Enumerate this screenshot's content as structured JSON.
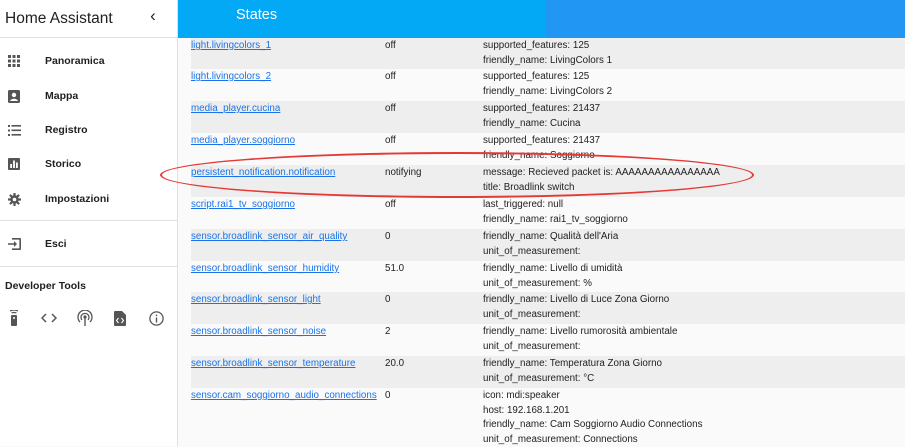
{
  "sidebar": {
    "title": "Home Assistant",
    "items": [
      {
        "label": "Panoramica",
        "icon": "apps-grid-icon"
      },
      {
        "label": "Mappa",
        "icon": "account-box-icon"
      },
      {
        "label": "Registro",
        "icon": "format-list-icon"
      },
      {
        "label": "Storico",
        "icon": "chart-bar-icon"
      },
      {
        "label": "Impostazioni",
        "icon": "gear-icon"
      },
      {
        "label": "Esci",
        "icon": "exit-icon"
      }
    ],
    "dev_tools_title": "Developer Tools",
    "dev_tools": [
      "remote-icon",
      "code-brackets-icon",
      "access-point-icon",
      "file-code-icon",
      "info-icon"
    ]
  },
  "header": {
    "title": "States"
  },
  "rows": [
    {
      "entity": "light.livingcolors_1",
      "state": "off",
      "attrs": [
        "supported_features: 125",
        "friendly_name: LivingColors 1"
      ]
    },
    {
      "entity": "light.livingcolors_2",
      "state": "off",
      "attrs": [
        "supported_features: 125",
        "friendly_name: LivingColors 2"
      ]
    },
    {
      "entity": "media_player.cucina",
      "state": "off",
      "attrs": [
        "supported_features: 21437",
        "friendly_name: Cucina"
      ]
    },
    {
      "entity": "media_player.soggiorno",
      "state": "off",
      "attrs": [
        "supported_features: 21437",
        "friendly_name: Soggiorno"
      ]
    },
    {
      "entity": "persistent_notification.notification",
      "state": "notifying",
      "attrs": [
        "message: Recieved packet is: AAAAAAAAAAAAAAAA",
        "title: Broadlink switch"
      ]
    },
    {
      "entity": "script.rai1_tv_soggiorno",
      "state": "off",
      "attrs": [
        "last_triggered: null",
        "friendly_name: rai1_tv_soggiorno"
      ]
    },
    {
      "entity": "sensor.broadlink_sensor_air_quality",
      "state": "0",
      "attrs": [
        "friendly_name: Qualità dell'Aria",
        "unit_of_measurement:"
      ]
    },
    {
      "entity": "sensor.broadlink_sensor_humidity",
      "state": "51.0",
      "attrs": [
        "friendly_name: Livello di umidità",
        "unit_of_measurement: %"
      ]
    },
    {
      "entity": "sensor.broadlink_sensor_light",
      "state": "0",
      "attrs": [
        "friendly_name: Livello di Luce Zona Giorno",
        "unit_of_measurement:"
      ]
    },
    {
      "entity": "sensor.broadlink_sensor_noise",
      "state": "2",
      "attrs": [
        "friendly_name: Livello rumorosità ambientale",
        "unit_of_measurement:"
      ]
    },
    {
      "entity": "sensor.broadlink_sensor_temperature",
      "state": "20.0",
      "attrs": [
        "friendly_name: Temperatura Zona Giorno",
        "unit_of_measurement: °C"
      ]
    },
    {
      "entity": "sensor.cam_soggiorno_audio_connections",
      "state": "0",
      "attrs": [
        "icon: mdi:speaker",
        "host: 192.168.1.201",
        "friendly_name: Cam Soggiorno Audio Connections",
        "unit_of_measurement: Connections"
      ]
    }
  ],
  "colors": {
    "header_primary": "#03a9f4",
    "header_secondary": "#2196f3",
    "link": "#1a73e8",
    "annotation": "#e53935"
  }
}
